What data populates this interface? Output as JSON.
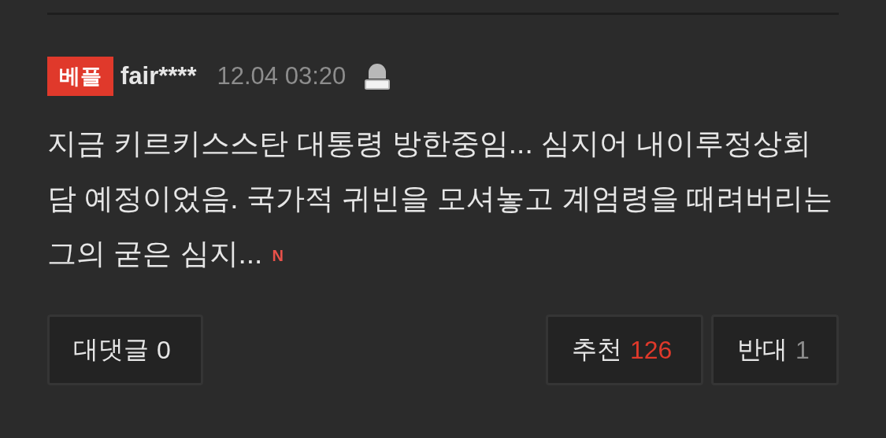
{
  "comment": {
    "badge": "베플",
    "author": "fair****",
    "time": "12.04 03:20",
    "body": "지금 키르키스스탄 대통령 방한중임... 심지어 내이루정상회담 예정이었음. 국가적 귀빈을 모셔놓고 계엄령을 때려버리는 그의 굳은 심지...",
    "new_mark": "N"
  },
  "actions": {
    "reply": {
      "label": "대댓글",
      "count": "0"
    },
    "like": {
      "label": "추천",
      "count": "126"
    },
    "dislike": {
      "label": "반대",
      "count": "1"
    }
  }
}
